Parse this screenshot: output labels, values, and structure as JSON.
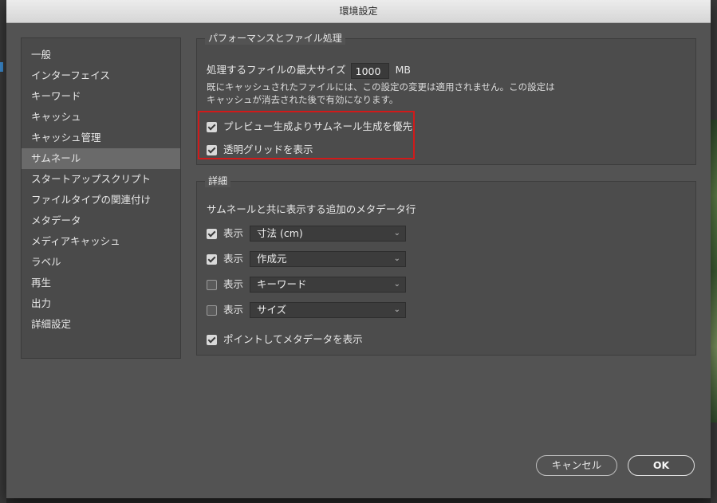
{
  "window": {
    "title": "環境設定"
  },
  "sidebar": {
    "items": [
      {
        "label": "一般"
      },
      {
        "label": "インターフェイス"
      },
      {
        "label": "キーワード"
      },
      {
        "label": "キャッシュ"
      },
      {
        "label": "キャッシュ管理"
      },
      {
        "label": "サムネール",
        "selected": true
      },
      {
        "label": "スタートアップスクリプト"
      },
      {
        "label": "ファイルタイプの関連付け"
      },
      {
        "label": "メタデータ"
      },
      {
        "label": "メディアキャッシュ"
      },
      {
        "label": "ラベル"
      },
      {
        "label": "再生"
      },
      {
        "label": "出力"
      },
      {
        "label": "詳細設定"
      }
    ]
  },
  "performance": {
    "title": "パフォーマンスとファイル処理",
    "max_size_label": "処理するファイルの最大サイズ",
    "max_size_value": "1000",
    "max_size_unit": "MB",
    "note_line1": "既にキャッシュされたファイルには、この設定の変更は適用されません。この設定は",
    "note_line2": "キャッシュが消去された後で有効になります。",
    "prefer_thumbnail": {
      "label": "プレビュー生成よりサムネール生成を優先",
      "checked": true
    },
    "show_transparency_grid": {
      "label": "透明グリッドを表示",
      "checked": true
    }
  },
  "details": {
    "title": "詳細",
    "subtitle": "サムネールと共に表示する追加のメタデータ行",
    "show_label": "表示",
    "rows": [
      {
        "checked": true,
        "value": "寸法 (cm)"
      },
      {
        "checked": true,
        "value": "作成元"
      },
      {
        "checked": false,
        "value": "キーワード"
      },
      {
        "checked": false,
        "value": "サイズ"
      }
    ],
    "hover_metadata": {
      "label": "ポイントしてメタデータを表示",
      "checked": true
    }
  },
  "buttons": {
    "cancel": "キャンセル",
    "ok": "OK"
  },
  "colors": {
    "highlight": "#d11a1a",
    "panel": "#535353"
  }
}
